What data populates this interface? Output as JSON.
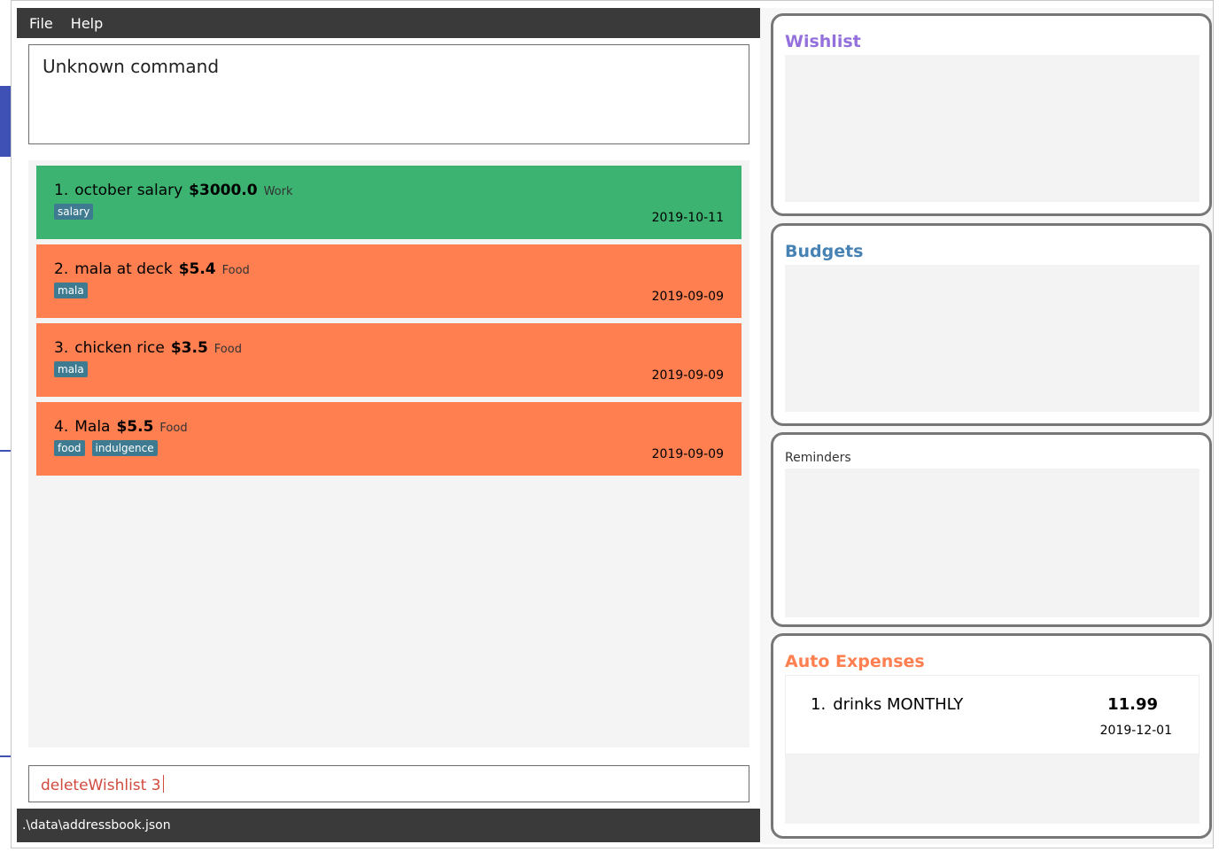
{
  "menu": {
    "file_label": "File",
    "help_label": "Help"
  },
  "result_display": {
    "text": "Unknown command"
  },
  "entries": [
    {
      "index": "1.",
      "description": "october salary",
      "amount": "$3000.0",
      "category": "Work",
      "tags": [
        "salary"
      ],
      "date": "2019-10-11",
      "kind": "income"
    },
    {
      "index": "2.",
      "description": "mala at deck",
      "amount": "$5.4",
      "category": "Food",
      "tags": [
        "mala"
      ],
      "date": "2019-09-09",
      "kind": "expense"
    },
    {
      "index": "3.",
      "description": "chicken rice",
      "amount": "$3.5",
      "category": "Food",
      "tags": [
        "mala"
      ],
      "date": "2019-09-09",
      "kind": "expense"
    },
    {
      "index": "4.",
      "description": "Mala",
      "amount": "$5.5",
      "category": "Food",
      "tags": [
        "food",
        "indulgence"
      ],
      "date": "2019-09-09",
      "kind": "expense"
    }
  ],
  "command_box": {
    "value": "deleteWishlist 3"
  },
  "status_bar": {
    "path": ".\\data\\addressbook.json"
  },
  "panels": {
    "wishlist": {
      "title": "Wishlist",
      "color": "#9370db"
    },
    "budgets": {
      "title": "Budgets",
      "color": "#4682b4"
    },
    "reminders": {
      "title": "Reminders"
    },
    "auto_expenses": {
      "title": "Auto Expenses",
      "color": "#ff7f50",
      "items": [
        {
          "index": "1.",
          "description": "drinks MONTHLY",
          "amount": "11.99",
          "date": "2019-12-01"
        }
      ]
    }
  },
  "colors": {
    "income": "#3cb371",
    "expense": "#ff7f50",
    "tag": "#3e7b91",
    "command_text": "#d04a3e",
    "menubar": "#3a3a3a"
  }
}
